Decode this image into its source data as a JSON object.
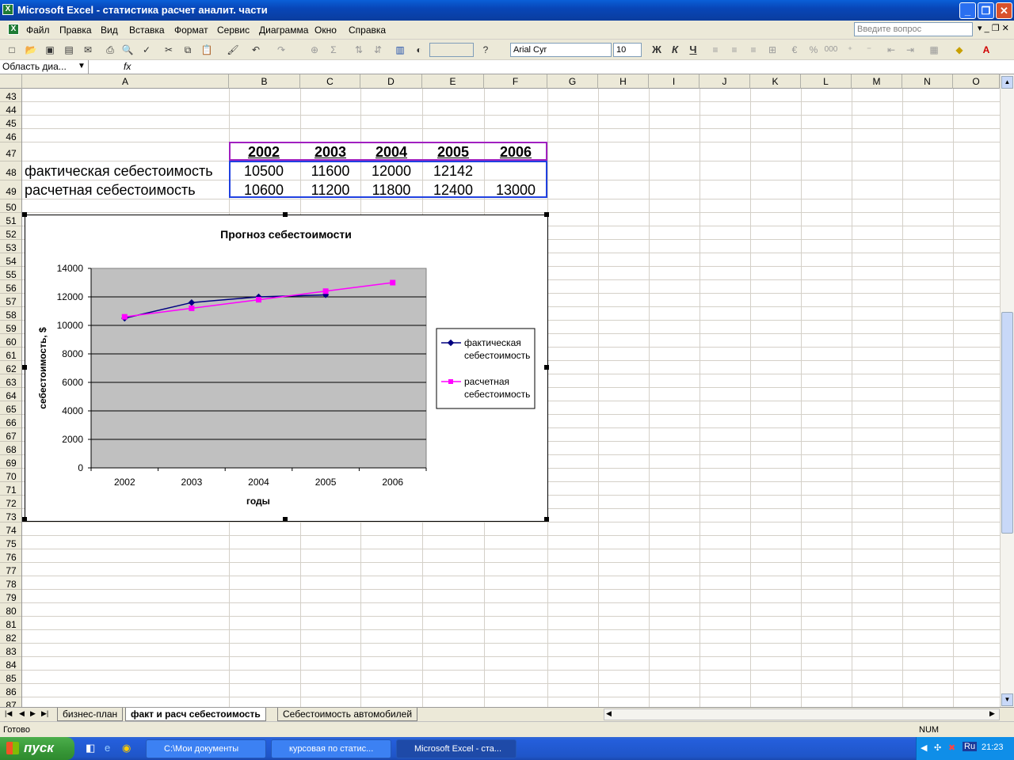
{
  "window": {
    "title": "Microsoft Excel - статистика расчет аналит. части",
    "minimize": "_",
    "maximize": "❐",
    "close": "✕"
  },
  "menu": {
    "items": [
      "Файл",
      "Правка",
      "Вид",
      "Вставка",
      "Формат",
      "Сервис",
      "Диаграмма",
      "Окно",
      "Справка"
    ],
    "ask_placeholder": "Введите вопрос"
  },
  "toolbar": {
    "font_name": "Arial Cyr",
    "font_size": "10",
    "bold": "Ж",
    "italic": "К",
    "underline": "Ч"
  },
  "formula_bar": {
    "name_box": "Область диа...",
    "fx": "fx"
  },
  "columns": [
    "A",
    "B",
    "C",
    "D",
    "E",
    "F",
    "G",
    "H",
    "I",
    "J",
    "K",
    "L",
    "M",
    "N",
    "O"
  ],
  "rows": [
    "43",
    "44",
    "45",
    "46",
    "47",
    "48",
    "49",
    "50",
    "51",
    "52",
    "53",
    "54",
    "55",
    "56",
    "57",
    "58",
    "59",
    "60",
    "61",
    "62",
    "63",
    "64",
    "65",
    "66",
    "67",
    "68",
    "69",
    "70",
    "71",
    "72",
    "73",
    "74",
    "75",
    "76",
    "77",
    "78",
    "79",
    "80",
    "81",
    "82",
    "83",
    "84",
    "85",
    "86",
    "87"
  ],
  "table": {
    "years": [
      "2002",
      "2003",
      "2004",
      "2005",
      "2006"
    ],
    "row1_label": "фактическая себестоимость",
    "row1_values": [
      "10500",
      "11600",
      "12000",
      "12142",
      ""
    ],
    "row2_label": "расчетная себестоимость",
    "row2_values": [
      "10600",
      "11200",
      "11800",
      "12400",
      "13000"
    ]
  },
  "chart_data": {
    "type": "line",
    "title": "Прогноз себестоимости",
    "xlabel": "годы",
    "ylabel": "себестоимость, $",
    "categories": [
      "2002",
      "2003",
      "2004",
      "2005",
      "2006"
    ],
    "ylim": [
      0,
      14000
    ],
    "yticks": [
      "0",
      "2000",
      "4000",
      "6000",
      "8000",
      "10000",
      "12000",
      "14000"
    ],
    "grid": true,
    "plot_background": "#c0c0c0",
    "legend_position": "right",
    "series": [
      {
        "name": "фактическая себестоимость",
        "values": [
          10500,
          11600,
          12000,
          12142,
          null
        ],
        "color": "#000080",
        "marker": "diamond"
      },
      {
        "name": "расчетная себестоимость",
        "values": [
          10600,
          11200,
          11800,
          12400,
          13000
        ],
        "color": "#ff00ff",
        "marker": "square"
      }
    ],
    "legend": {
      "line1a": "фактическая",
      "line1b": "себестоимость",
      "line2a": "расчетная",
      "line2b": "себестоимость"
    }
  },
  "sheet_tabs": [
    "бизнес-план",
    "факт и расч себестоимость",
    "Себестоимость автомобилей"
  ],
  "active_tab": "факт и расч себестоимость",
  "status": {
    "ready": "Готово",
    "num": "NUM"
  },
  "taskbar": {
    "start": "пуск",
    "tasks": [
      "C:\\Мои документы",
      "курсовая по статис...",
      "Microsoft Excel - ста..."
    ],
    "lang": "Ru",
    "clock": "21:23"
  }
}
